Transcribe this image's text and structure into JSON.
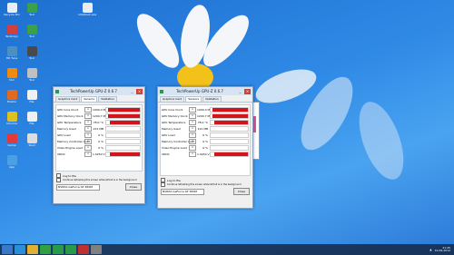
{
  "desktop": {
    "icons": [
      {
        "label": "Recycle Bin",
        "color": "#e8eef7"
      },
      {
        "label": "TeraCopy",
        "color": "#d04040"
      },
      {
        "label": "HD Tune",
        "color": "#4a90c0"
      },
      {
        "label": "VLC",
        "color": "#f08a10"
      },
      {
        "label": "Firefox",
        "color": "#e06a20"
      },
      {
        "label": "Chrome",
        "color": "#e0c020"
      },
      {
        "label": "Game",
        "color": "#e23a3a"
      },
      {
        "label": "App",
        "color": "#4aa0e0"
      },
      {
        "label": "Tool",
        "color": "#3aa04a"
      },
      {
        "label": "Tool",
        "color": "#3aa04a"
      },
      {
        "label": "Tool",
        "color": "#4a4a4a"
      },
      {
        "label": "Tool",
        "color": "#c0c0c0"
      },
      {
        "label": "File",
        "color": "#f0f0f0"
      },
      {
        "label": "File",
        "color": "#f0f0f0"
      },
      {
        "label": "Skull",
        "color": "#dddddd"
      }
    ],
    "top_file": "notebook.exe"
  },
  "windows": [
    {
      "title": "TechPowerUp GPU-Z 0.6.7",
      "tabs": [
        "Graphics Card",
        "Sensors",
        "Validation"
      ],
      "active_tab": 1,
      "sensors": [
        {
          "label": "GPU Core Clock",
          "value": "1000.0 MHz",
          "fill": 0.95
        },
        {
          "label": "GPU Memory Clock",
          "value": "1200.7 MHz",
          "fill": 0.95
        },
        {
          "label": "GPU Temperature",
          "value": "78.0 °C",
          "fill": 0.9
        },
        {
          "label": "Memory Used",
          "value": "221 MB",
          "fill": 0.0
        },
        {
          "label": "GPU Load",
          "value": "0 %",
          "fill": 0.0
        },
        {
          "label": "Memory Controller Load",
          "value": "0 %",
          "fill": 0.0
        },
        {
          "label": "Video Engine Load",
          "value": "0 %",
          "fill": 0.0
        },
        {
          "label": "VDDC",
          "value": "1.0250 V",
          "fill": 0.9
        }
      ],
      "log_label": "Log to file",
      "continue_label": "Continue refreshing this screen while GPU-Z is in the background",
      "gpu_select": "NVIDIA GeForce GT 650M",
      "close_label": "Close"
    },
    {
      "title": "TechPowerUp GPU-Z 0.6.7",
      "tabs": [
        "Graphics Card",
        "Sensors",
        "Validation"
      ],
      "active_tab": 1,
      "sensors": [
        {
          "label": "GPU Core Clock",
          "value": "1000.0 MHz",
          "fill": 0.95
        },
        {
          "label": "GPU Memory Clock",
          "value": "1200.7 MHz",
          "fill": 0.95
        },
        {
          "label": "GPU Temperature",
          "value": "78.0 °C",
          "fill": 0.9
        },
        {
          "label": "Memory Used",
          "value": "221 MB",
          "fill": 0.0
        },
        {
          "label": "GPU Load",
          "value": "0 %",
          "fill": 0.0
        },
        {
          "label": "Memory Controller Load",
          "value": "0 %",
          "fill": 0.0
        },
        {
          "label": "Video Engine Load",
          "value": "0 %",
          "fill": 0.0
        },
        {
          "label": "VDDC",
          "value": "1.0250 V",
          "fill": 0.9
        }
      ],
      "log_label": "Log to file",
      "continue_label": "Continue refreshing this screen while GPU-Z is in the background",
      "gpu_select": "NVIDIA GeForce GT 650M",
      "close_label": "Close"
    }
  ],
  "taskbar": {
    "items": [
      {
        "icon": "start-icon",
        "color": "#3a78c8"
      },
      {
        "icon": "ie-icon",
        "color": "#2a8fd8"
      },
      {
        "icon": "folder-icon",
        "color": "#e0b030"
      },
      {
        "icon": "chrome-icon",
        "color": "#30a040"
      },
      {
        "icon": "gpuz-icon",
        "color": "#2a9a4a"
      },
      {
        "icon": "gpuz-icon",
        "color": "#2a9a4a"
      },
      {
        "icon": "app-icon",
        "color": "#c03030"
      },
      {
        "icon": "app-icon",
        "color": "#808080"
      }
    ],
    "time": "21:45",
    "date": "10-09-2012"
  }
}
